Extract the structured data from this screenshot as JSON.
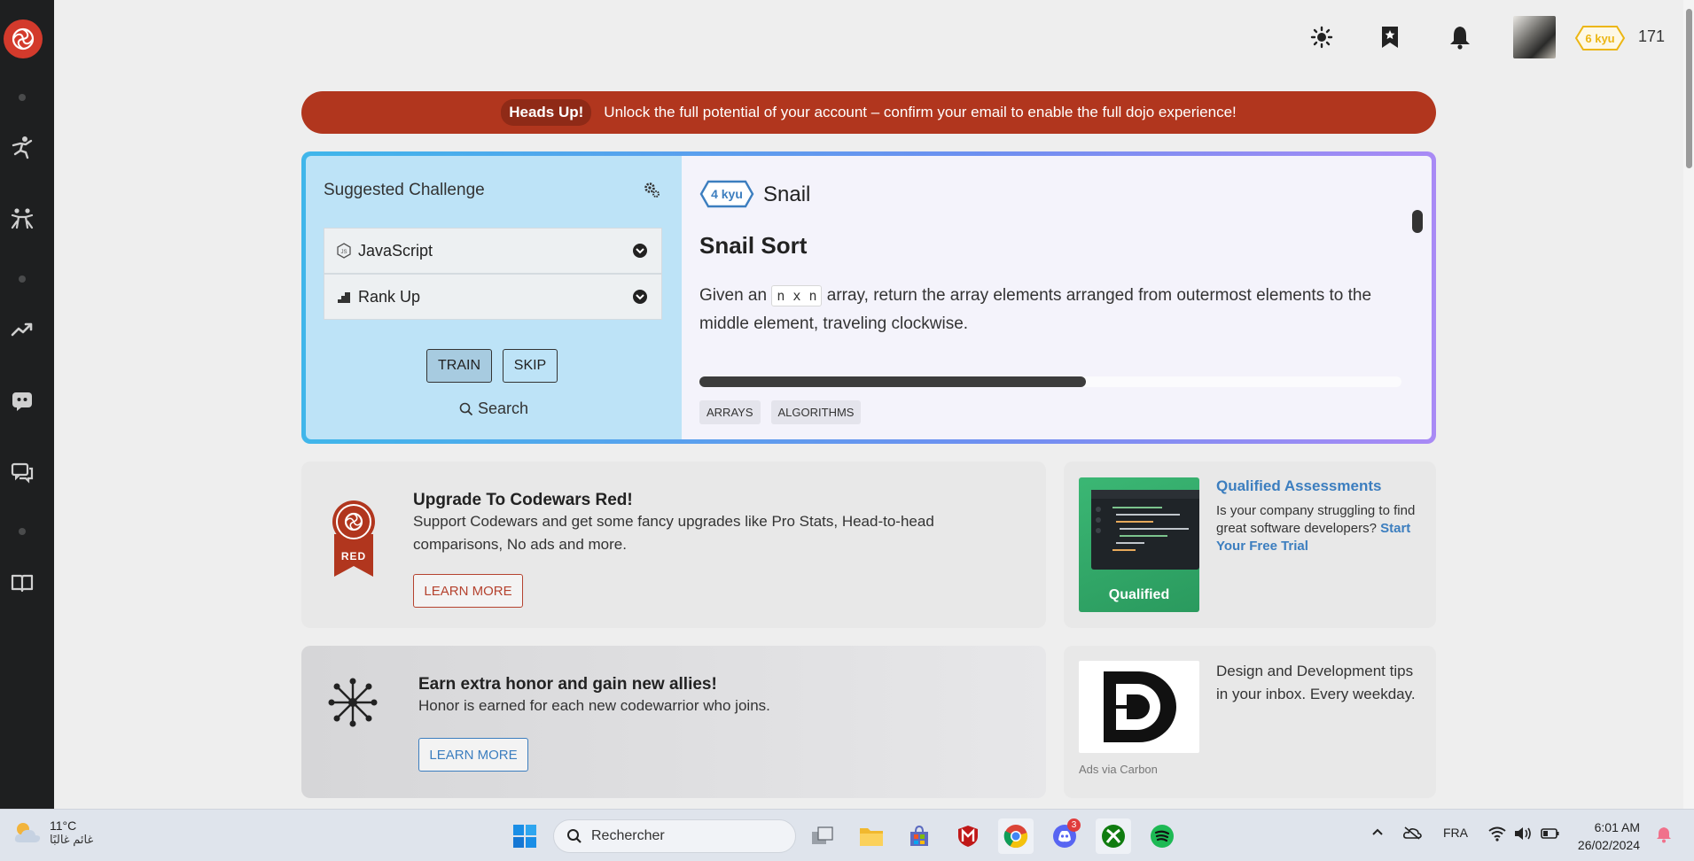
{
  "header": {
    "rank": "6 kyu",
    "honor": "171"
  },
  "banner": {
    "pill": "Heads Up!",
    "message": "Unlock the full potential of your account – confirm your email to enable the full dojo experience!"
  },
  "challenge": {
    "title": "Suggested Challenge",
    "language": "JavaScript",
    "strategy": "Rank Up",
    "train_label": "TRAIN",
    "skip_label": "SKIP",
    "search_label": "Search",
    "kata_rank": "4 kyu",
    "kata_name": "Snail",
    "kata_heading": "Snail Sort",
    "desc_before": "Given an ",
    "desc_code": "n x n",
    "desc_after": " array, return the array elements arranged from outermost elements to the middle element, traveling clockwise.",
    "progress": 0.55,
    "tags": [
      "ARRAYS",
      "ALGORITHMS"
    ]
  },
  "red_card": {
    "badge_text": "RED",
    "title": "Upgrade To Codewars Red!",
    "text": "Support Codewars and get some fancy upgrades like Pro Stats, Head-to-head comparisons, No ads and more.",
    "button": "LEARN MORE"
  },
  "honor_card": {
    "title": "Earn extra honor and gain new allies!",
    "text": "Honor is earned for each new codewarrior who joins.",
    "button": "LEARN MORE"
  },
  "qualified": {
    "image_label": "Qualified",
    "title": "Qualified Assessments",
    "text": "Is your company struggling to find great software developers?",
    "link": "Start Your Free Trial"
  },
  "carbon": {
    "text": "Design and Development tips in your inbox. Every weekday.",
    "ad_label": "Ads via Carbon"
  },
  "taskbar": {
    "temperature": "11°C",
    "weather": "غائم غالبًا",
    "search_placeholder": "Rechercher",
    "discord_badge": "3",
    "language": "FRA",
    "time": "6:01 AM",
    "date": "26/02/2024"
  },
  "colors": {
    "sidebar": "#1e1f20",
    "brand_red": "#d33a2c",
    "banner": "#b1361e",
    "kyu_blue": "#3c7ebf",
    "rank_yellow": "#ecb613"
  }
}
